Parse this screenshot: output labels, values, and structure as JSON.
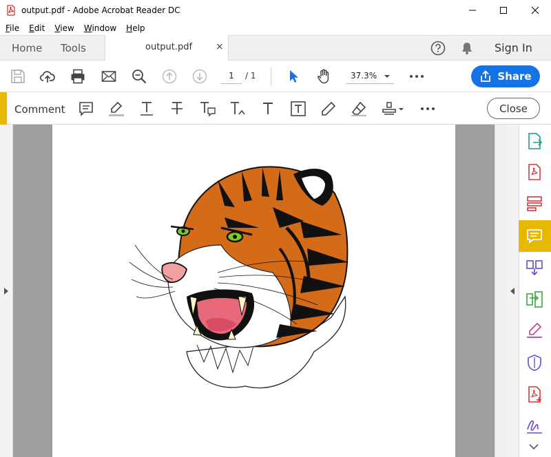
{
  "window": {
    "title": "output.pdf - Adobe Acrobat Reader DC"
  },
  "menu": [
    "File",
    "Edit",
    "View",
    "Window",
    "Help"
  ],
  "tabs": {
    "home": "Home",
    "tools": "Tools",
    "document": "output.pdf",
    "close_glyph": "×",
    "sign_in": "Sign In"
  },
  "toolbar": {
    "page_current": "1",
    "page_total": "/ 1",
    "zoom": "37.3%",
    "share_label": "Share"
  },
  "comment_bar": {
    "label": "Comment",
    "close_label": "Close"
  },
  "colors": {
    "accent_blue": "#1473e6",
    "comment_yellow": "#e6b800",
    "canvas_gray": "#9e9e9e"
  },
  "document": {
    "content": "tiger-head-illustration"
  }
}
